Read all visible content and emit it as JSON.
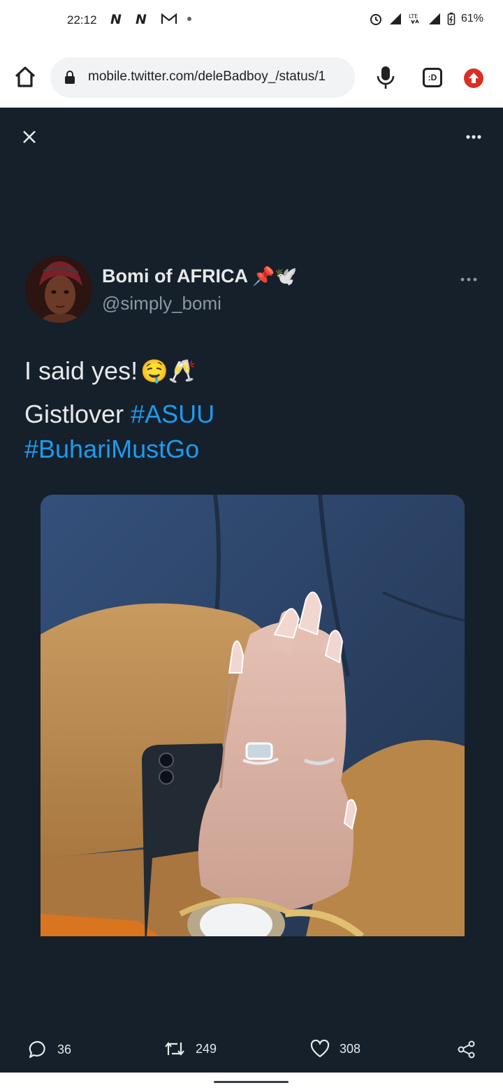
{
  "status_bar": {
    "time": "22:12",
    "battery": "61%",
    "network": "LTE"
  },
  "browser": {
    "url": "mobile.twitter.com/deleBadboy_/status/1",
    "tab_switcher_label": ":D"
  },
  "tweet": {
    "display_name": "Bomi of AFRICA",
    "name_emojis": "📌🕊️",
    "handle": "@simply_bomi",
    "line1_text": "I said yes!",
    "line1_emojis": "🤤🥂",
    "line2_text": "Gistlover ",
    "hashtag_1": "#ASUU",
    "hashtag_2": "#BuhariMustGo"
  },
  "actions": {
    "replies": "36",
    "retweets": "249",
    "likes": "308"
  },
  "colors": {
    "background_dark": "#15202b",
    "text_primary": "#e7e9ea",
    "text_secondary": "#8b98a5",
    "link_blue": "#1d9bf0"
  },
  "icons": [
    "home-icon",
    "lock-icon",
    "mic-icon",
    "tab-switcher-icon",
    "update-icon",
    "close-icon",
    "more-icon",
    "reply-icon",
    "retweet-icon",
    "like-icon",
    "share-icon"
  ]
}
